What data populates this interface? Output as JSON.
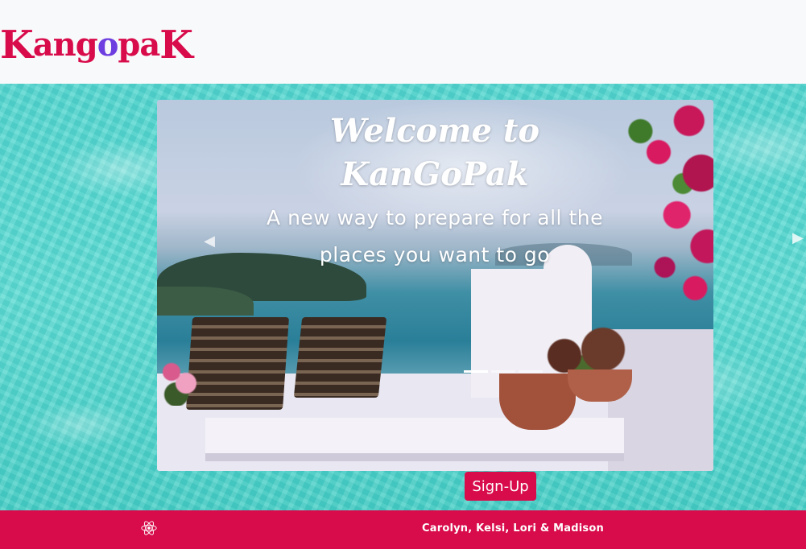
{
  "navbar": {
    "logo": {
      "parts": [
        "K",
        "ang",
        "o",
        "pa",
        "K"
      ]
    }
  },
  "carousel": {
    "title_line1": "Welcome to",
    "title_line2": "KanGoPak",
    "subtitle_line1": "A new way to prepare for all the",
    "subtitle_line2": "places you want to go",
    "indicator_count": 3,
    "active_index": 0,
    "prev_icon": "chevron-left-icon",
    "next_icon": "chevron-right-icon"
  },
  "signup_label": "Sign-Up",
  "footer": {
    "icon": "react-icon",
    "credits": "Carolyn, Kelsi, Lori & Madison"
  },
  "colors": {
    "brand": "#d80b4b",
    "accent": "#6d3ee0",
    "water": "#54d6cf",
    "header_bg": "#f8f9fa"
  }
}
